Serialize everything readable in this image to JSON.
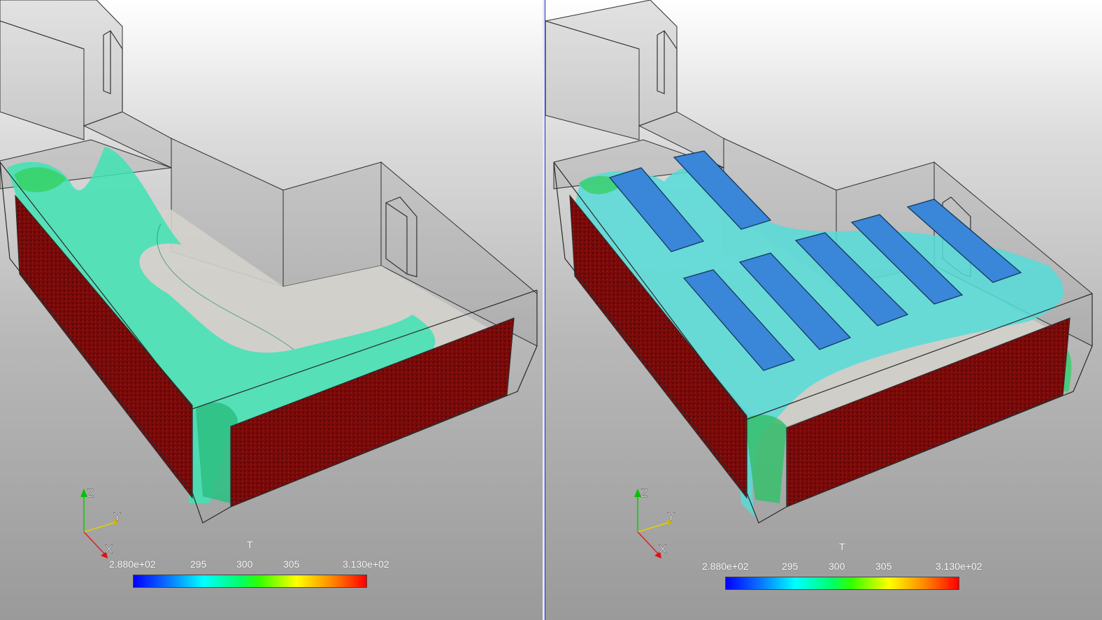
{
  "views": [
    {
      "id": "left",
      "axes": {
        "x": "X",
        "y": "Y",
        "z": "Z"
      },
      "color_legend": {
        "title": "T",
        "min_label": "2.880e+02",
        "ticks": [
          "295",
          "300",
          "305"
        ],
        "max_label": "3.130e+02",
        "colormap": [
          "#0000ff",
          "#00ffff",
          "#00ff00",
          "#ffff00",
          "#ff0000"
        ]
      }
    },
    {
      "id": "right",
      "axes": {
        "x": "X",
        "y": "Y",
        "z": "Z"
      },
      "color_legend": {
        "title": "T",
        "min_label": "2.880e+02",
        "ticks": [
          "295",
          "300",
          "305"
        ],
        "max_label": "3.130e+02",
        "colormap": [
          "#0000ff",
          "#00ffff",
          "#00ff00",
          "#ffff00",
          "#ff0000"
        ]
      }
    }
  ],
  "colors": {
    "heater_panel": "#7a0a0a",
    "isosurface": "#3fe3b4",
    "isosurface_right": "#56dcd8",
    "panel_blue": "#3a86d8",
    "active_view_border": "#1a2bd6"
  }
}
